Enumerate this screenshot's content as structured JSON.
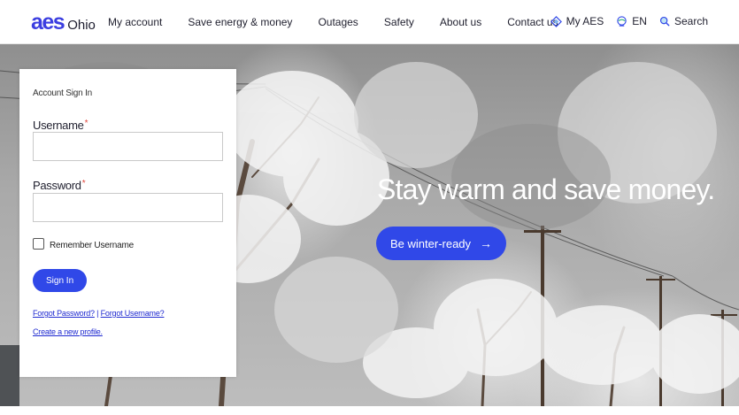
{
  "brand": {
    "logo_mark": "aes",
    "logo_region": "Ohio"
  },
  "nav": {
    "items": [
      {
        "label": "My account"
      },
      {
        "label": "Save energy & money"
      },
      {
        "label": "Outages"
      },
      {
        "label": "Safety"
      },
      {
        "label": "About us"
      },
      {
        "label": "Contact us"
      }
    ]
  },
  "utility": {
    "my_aes": "My AES",
    "language": "EN",
    "search": "Search"
  },
  "hero": {
    "headline": "Stay warm and save money.",
    "cta_label": "Be winter-ready",
    "cta_arrow": "→"
  },
  "signin": {
    "title": "Account Sign In",
    "username_label": "Username",
    "username_value": "",
    "password_label": "Password",
    "password_value": "",
    "required_mark": "*",
    "remember_label": "Remember Username",
    "remember_checked": false,
    "submit_label": "Sign In",
    "forgot_password": "Forgot Password?",
    "separator": "|",
    "forgot_username": "Forgot Username?",
    "create_profile": "Create a new profile."
  },
  "colors": {
    "brand_blue": "#3048e8",
    "link_blue": "#1f2ad0",
    "required_red": "#e0443a"
  }
}
